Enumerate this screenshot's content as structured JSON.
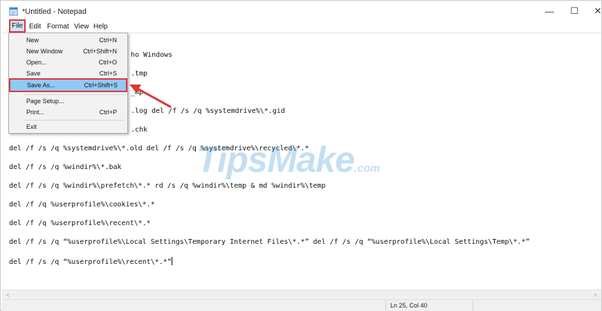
{
  "window": {
    "title": "*Untitled - Notepad",
    "controls": {
      "minimize": "—",
      "maximize": "☐",
      "close": "✕"
    }
  },
  "menubar": {
    "file": "File",
    "edit": "Edit",
    "format": "Format",
    "view": "View",
    "help": "Help"
  },
  "file_menu": {
    "items": [
      {
        "label": "New",
        "shortcut": "Ctrl+N"
      },
      {
        "label": "New Window",
        "shortcut": "Ctrl+Shift+N"
      },
      {
        "label": "Open...",
        "shortcut": "Ctrl+O"
      },
      {
        "label": "Save",
        "shortcut": "Ctrl+S"
      },
      {
        "label": "Save As...",
        "shortcut": "Ctrl+Shift+S"
      },
      {
        "label": "Page Setup...",
        "shortcut": ""
      },
      {
        "label": "Print...",
        "shortcut": "Ctrl+P"
      },
      {
        "label": "Exit",
        "shortcut": ""
      }
    ],
    "highlighted": "Save As..."
  },
  "editor": {
    "visible_fragments": [
      "ho Windows",
      ".tmp",
      "_mp",
      ".log del /f /s /q %systemdrive%\\*.gid",
      ".chk"
    ],
    "lines": [
      "del /f /s /q %systemdrive%\\*.old del /f /s /q %systemdrive%\\recycled\\*.*",
      "del /f /s /q %windir%\\*.bak",
      "del /f /s /q %windir%\\prefetch\\*.* rd /s /q %windir%\\temp & md %windir%\\temp",
      "del /f /q %userprofile%\\cookies\\*.*",
      "del /f /q %userprofile%\\recent\\*.*",
      "del /f /s /q “%userprofile%\\Local Settings\\Temporary Internet Files\\*.*” del /f /s /q “%userprofile%\\Local Settings\\Temp\\*.*”",
      "del /f /s /q “%userprofile%\\recent\\*.*”"
    ]
  },
  "watermark": {
    "main": "TipsMake",
    "suffix": ".com"
  },
  "scrollbar": {
    "left_arrow": "<",
    "right_arrow": ">"
  },
  "statusbar": {
    "position": "Ln 25, Col 40"
  },
  "colors": {
    "highlight_border": "#e03535",
    "menu_highlight": "#91c9f7",
    "watermark": "#2a8fd6"
  }
}
